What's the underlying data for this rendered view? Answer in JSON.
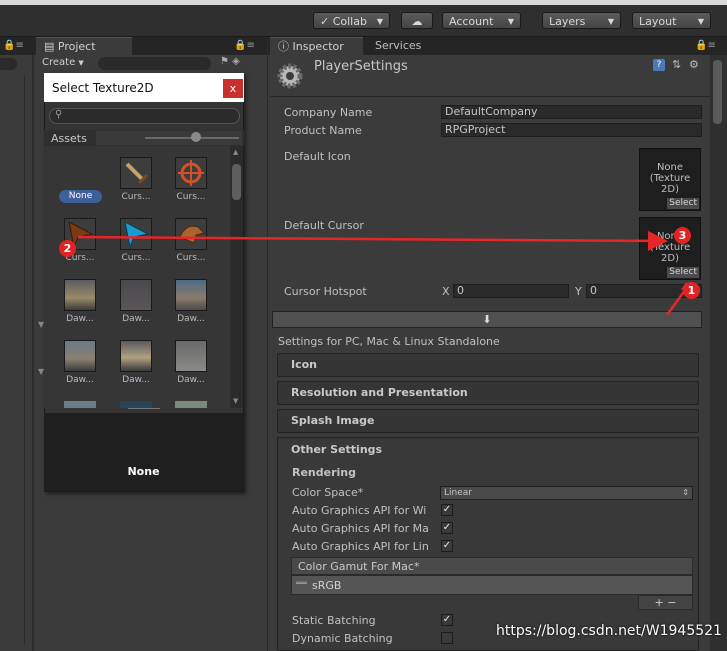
{
  "toolbar": {
    "collab_label": "Collab",
    "account_label": "Account",
    "layers_label": "Layers",
    "layout_label": "Layout"
  },
  "project_panel": {
    "tab_label": "Project",
    "create_label": "Create"
  },
  "dialog": {
    "title": "Select Texture2D",
    "close_label": "x",
    "search_value": "",
    "assets_label": "Assets",
    "items": [
      {
        "label": "None",
        "icon": "none-badge"
      },
      {
        "label": "Curs...",
        "icon": "sword-icon"
      },
      {
        "label": "Curs...",
        "icon": "crosshair-icon"
      },
      {
        "label": "Curs...",
        "icon": "cursor-arrow-brown-icon"
      },
      {
        "label": "Curs...",
        "icon": "cursor-arrow-blue-icon"
      },
      {
        "label": "Curs...",
        "icon": "gauntlet-icon"
      },
      {
        "label": "Daw...",
        "icon": "skybox-icon"
      },
      {
        "label": "Daw...",
        "icon": "skybox-icon"
      },
      {
        "label": "Daw...",
        "icon": "skybox-icon"
      },
      {
        "label": "Daw...",
        "icon": "skybox-icon"
      },
      {
        "label": "Daw...",
        "icon": "skybox-icon"
      },
      {
        "label": "Daw...",
        "icon": "skybox-icon"
      }
    ],
    "preview_label": "None"
  },
  "inspector": {
    "tab_inspector": "Inspector",
    "tab_services": "Services",
    "title": "PlayerSettings",
    "company_name_label": "Company Name",
    "company_name_value": "DefaultCompany",
    "product_name_label": "Product Name",
    "product_name_value": "RPGProject",
    "default_icon_label": "Default Icon",
    "default_icon_box": "None\n(Texture\n2D)",
    "select_label": "Select",
    "default_cursor_label": "Default Cursor",
    "default_cursor_box": "None\n(Texture\n2D)",
    "cursor_hotspot_label": "Cursor Hotspot",
    "hotspot_x_label": "X",
    "hotspot_x_value": "0",
    "hotspot_y_label": "Y",
    "hotspot_y_value": "0",
    "platform_label": "Settings for PC, Mac & Linux Standalone",
    "sections": [
      "Icon",
      "Resolution and Presentation",
      "Splash Image",
      "Other Settings"
    ],
    "rendering_label": "Rendering",
    "color_space_label": "Color Space*",
    "color_space_value": "Linear",
    "auto_api_win": "Auto Graphics API  for Wi",
    "auto_api_mac": "Auto Graphics API  for Ma",
    "auto_api_linux": "Auto Graphics API  for Lin",
    "color_gamut_label": "Color Gamut For Mac*",
    "color_gamut_item": "sRGB",
    "static_batching_label": "Static Batching",
    "dynamic_batching_label": "Dynamic Batching",
    "plus_minus": "+  −"
  },
  "annotations": {
    "marker_1": "1",
    "marker_2": "2",
    "marker_3": "3",
    "arrow_color": "#e8262a"
  },
  "watermark": "https://blog.csdn.net/W1945521"
}
